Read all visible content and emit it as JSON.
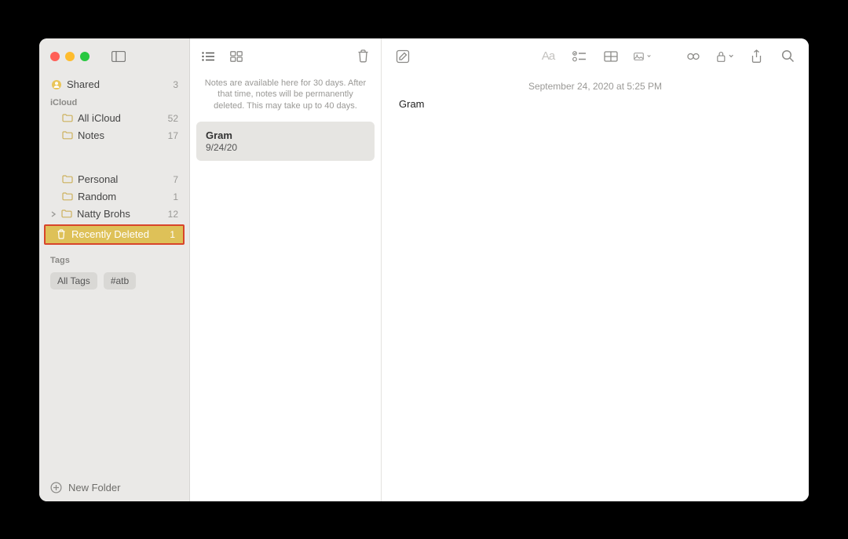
{
  "sidebar": {
    "shared": {
      "label": "Shared",
      "count": "3"
    },
    "section_icloud": "iCloud",
    "items": [
      {
        "label": "All iCloud",
        "count": "52"
      },
      {
        "label": "Notes",
        "count": "17"
      }
    ],
    "items2": [
      {
        "label": "Personal",
        "count": "7"
      },
      {
        "label": "Random",
        "count": "1"
      },
      {
        "label": "Natty Brohs",
        "count": "12",
        "expandable": true
      }
    ],
    "deleted": {
      "label": "Recently Deleted",
      "count": "1"
    },
    "section_tags": "Tags",
    "tags": [
      "All Tags",
      "#atb"
    ],
    "new_folder": "New Folder"
  },
  "list": {
    "info": "Notes are available here for 30 days. After that time, notes will be permanently deleted. This may take up to 40 days.",
    "selected": {
      "title": "Gram",
      "date": "9/24/20"
    }
  },
  "editor": {
    "date": "September 24, 2020 at 5:25 PM",
    "content": "Gram"
  }
}
